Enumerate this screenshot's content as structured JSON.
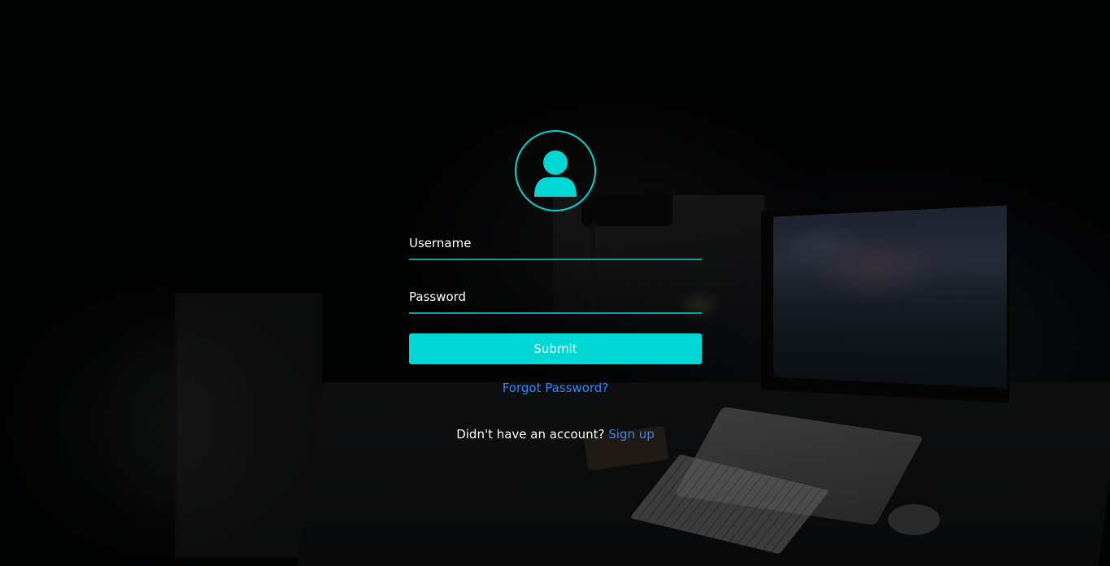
{
  "form": {
    "username_placeholder": "Username",
    "password_placeholder": "Password",
    "submit_label": "Submit",
    "forgot_password_label": "Forgot Password?",
    "signup_prompt": "Didn't have an account?",
    "signup_link_label": "Sign up"
  },
  "icons": {
    "avatar": "user-icon"
  },
  "colors": {
    "accent": "#00d6d3",
    "link": "#2f86ff",
    "input_underline": "#1a9c9b",
    "background": "#050607"
  }
}
